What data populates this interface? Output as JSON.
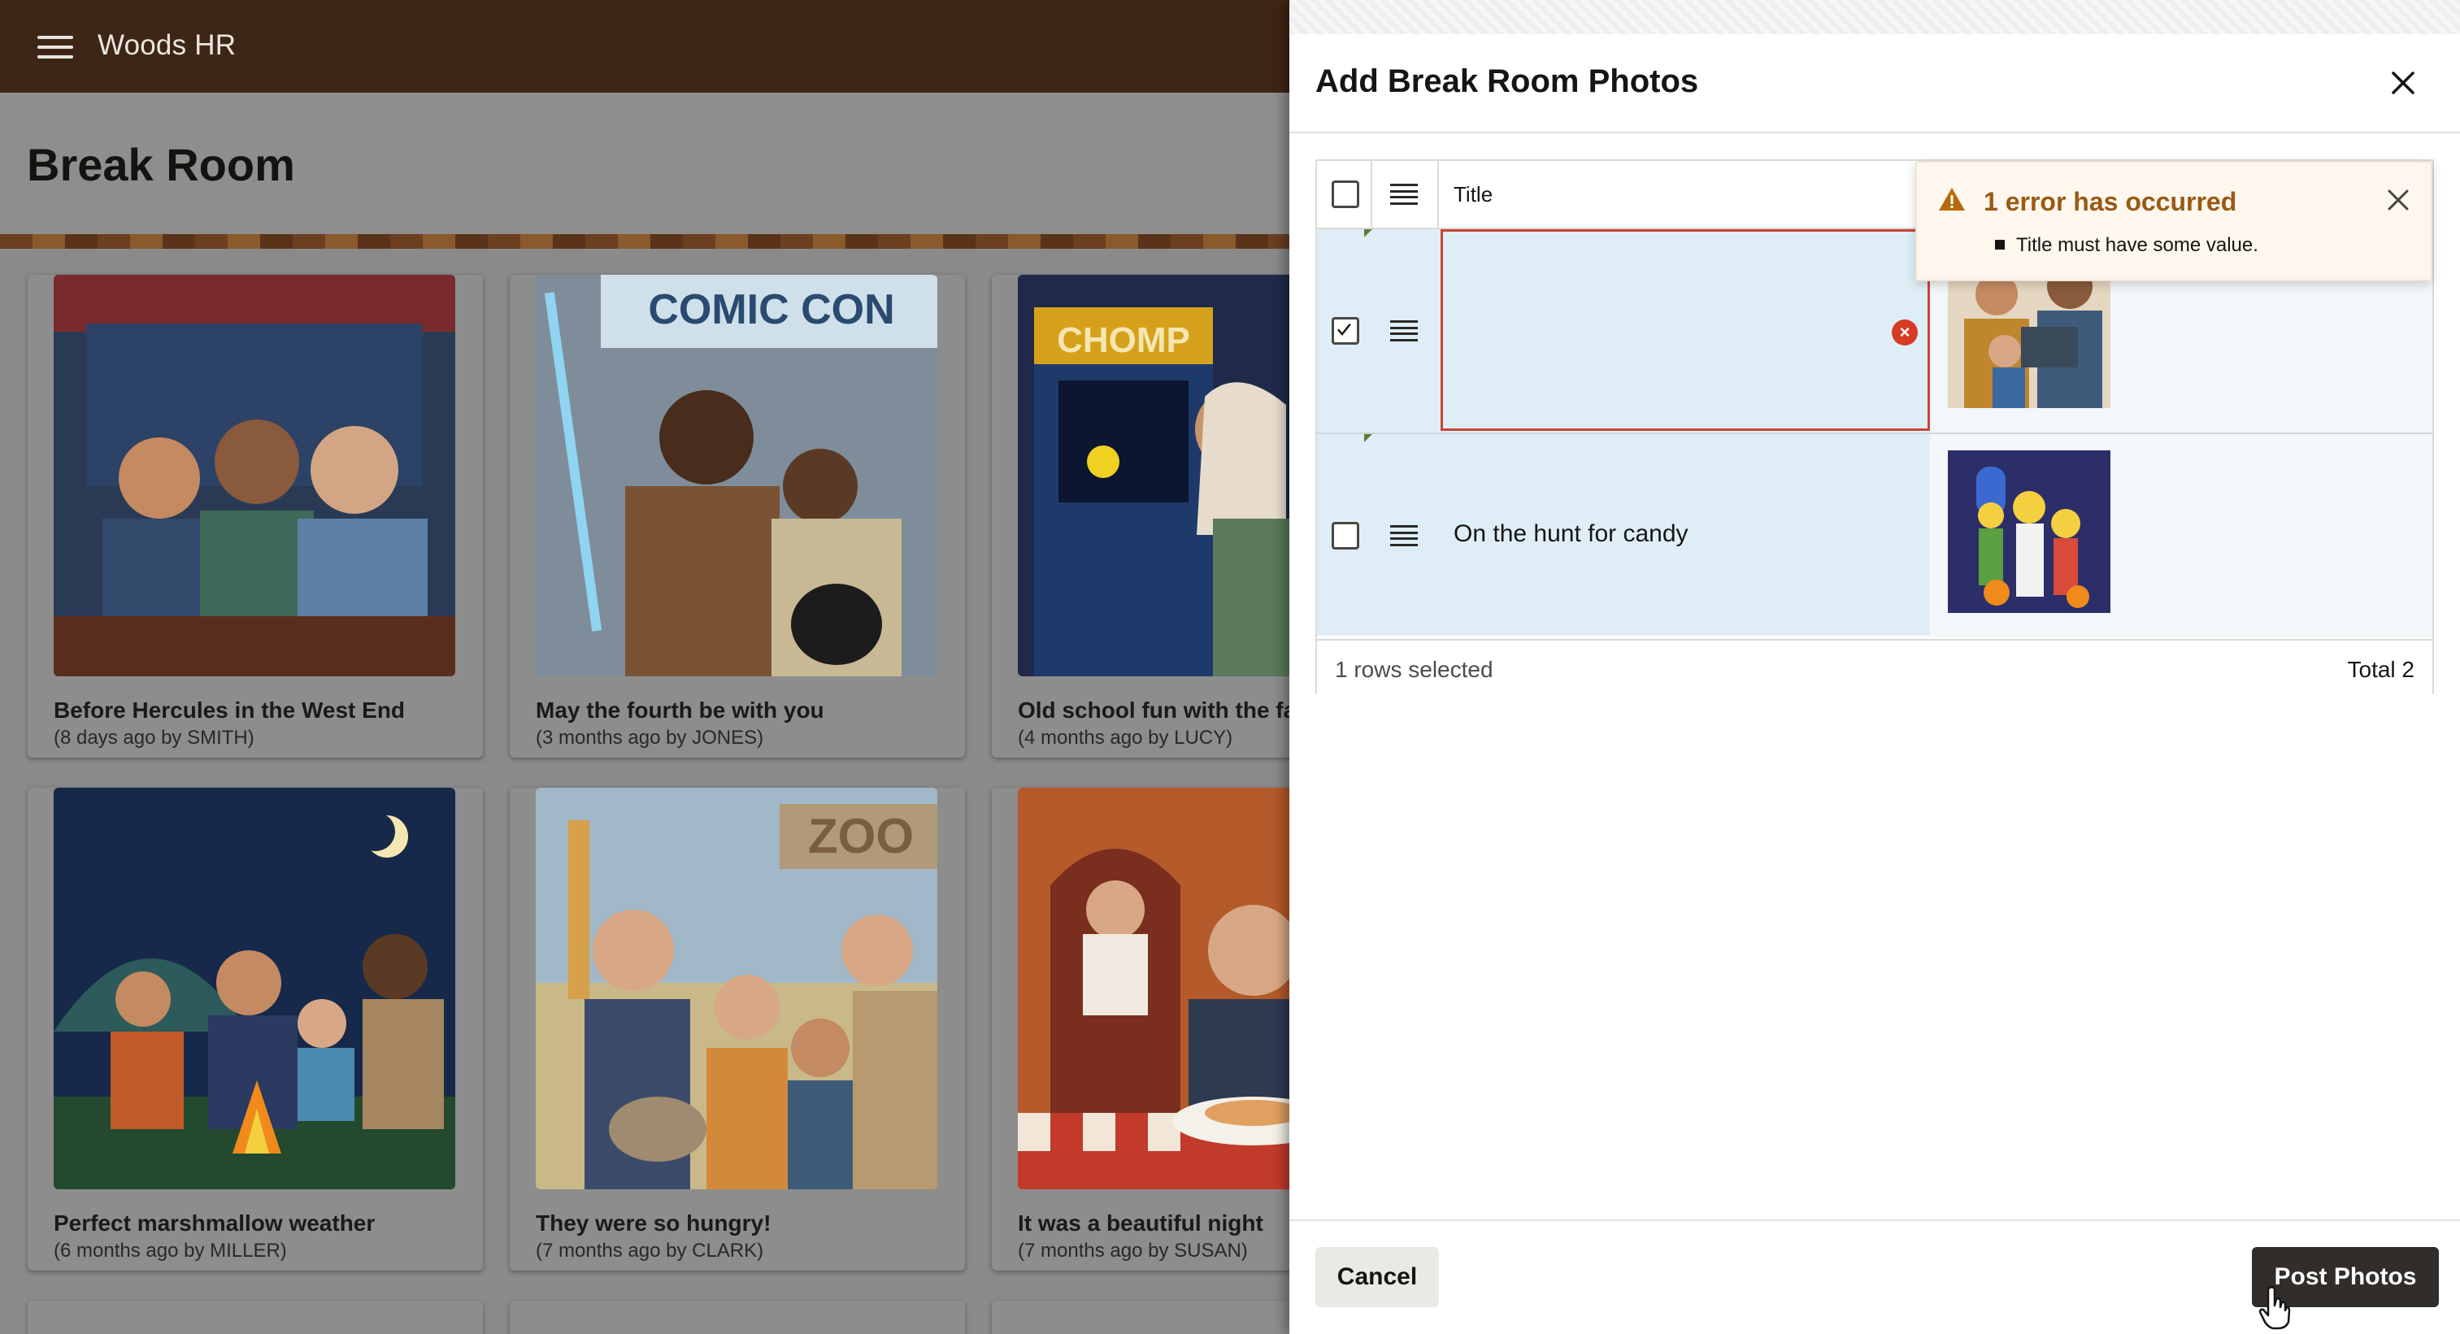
{
  "app": {
    "title": "Woods HR"
  },
  "page": {
    "title": "Break Room"
  },
  "cards": [
    {
      "caption": "Before Hercules in the West End",
      "meta": "(8 days ago by SMITH)"
    },
    {
      "caption": "May the fourth be with you",
      "meta": "(3 months ago by JONES)"
    },
    {
      "caption": "Old school fun with the fa",
      "meta": "(4 months ago by LUCY)"
    },
    {
      "caption": "Perfect marshmallow weather",
      "meta": "(6 months ago by MILLER)"
    },
    {
      "caption": "They were so hungry!",
      "meta": "(7 months ago by CLARK)"
    },
    {
      "caption": "It was a beautiful night",
      "meta": "(7 months ago by SUSAN)"
    }
  ],
  "image_text": {
    "comic": "COMIC CON",
    "chomp": "CHOMP",
    "zoo": "ZOO"
  },
  "drawer": {
    "title": "Add Break Room Photos",
    "grid": {
      "column_title": "Title",
      "rows": [
        {
          "title": "",
          "selected": true
        },
        {
          "title": "On the hunt for candy",
          "selected": false
        }
      ],
      "rows_selected": "1 rows selected",
      "total": "Total 2"
    },
    "error": {
      "heading": "1 error has occurred",
      "message": "Title must have some value.",
      "icon": "warning-icon"
    },
    "cancel_label": "Cancel",
    "post_label": "Post Photos"
  },
  "colors": {
    "topbar": "#3e2616",
    "error_border": "#c74634",
    "error_heading": "#9a5a12",
    "primary_button": "#312d2a",
    "row_selected": "#dfeef6"
  }
}
